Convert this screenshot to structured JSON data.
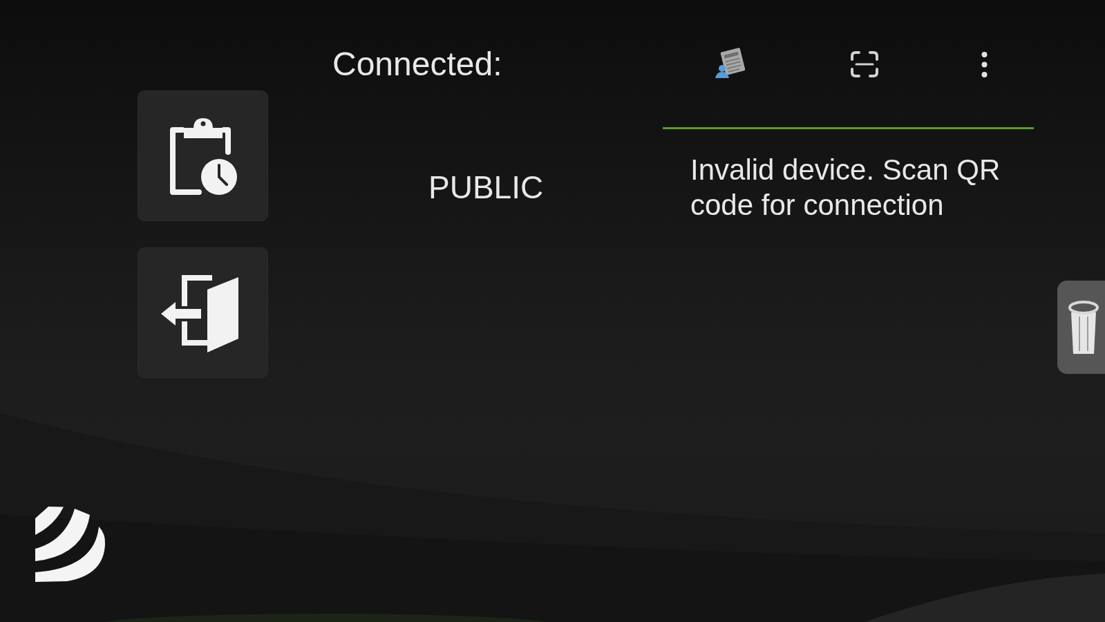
{
  "header": {
    "title": "Connected:"
  },
  "network": {
    "name": "PUBLIC"
  },
  "status": {
    "message": "Invalid device. Scan QR code for connection"
  }
}
